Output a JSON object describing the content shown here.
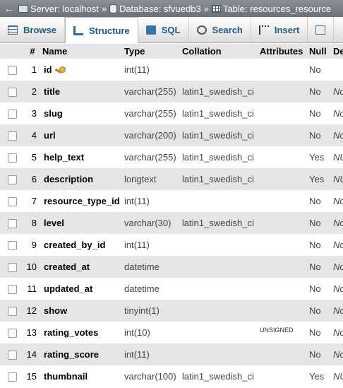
{
  "breadcrumb": {
    "server": "Server: localhost",
    "database": "Database: sfvuedb3",
    "table": "Table: resources_resource",
    "separator": "»"
  },
  "tabs": [
    {
      "label": "Browse",
      "icon": "browse-icon"
    },
    {
      "label": "Structure",
      "icon": "structure-icon",
      "active": true
    },
    {
      "label": "SQL",
      "icon": "sql-icon"
    },
    {
      "label": "Search",
      "icon": "search-icon"
    },
    {
      "label": "Insert",
      "icon": "insert-icon"
    }
  ],
  "columns": {
    "num": "#",
    "name": "Name",
    "type": "Type",
    "collation": "Collation",
    "attributes": "Attributes",
    "null": "Null",
    "default": "De"
  },
  "rows": [
    {
      "num": "1",
      "name": "id",
      "type": "int(11)",
      "collation": "",
      "attributes": "",
      "null": "No",
      "default": "",
      "primary_key": true
    },
    {
      "num": "2",
      "name": "title",
      "type": "varchar(255)",
      "collation": "latin1_swedish_ci",
      "attributes": "",
      "null": "No",
      "default": "No"
    },
    {
      "num": "3",
      "name": "slug",
      "type": "varchar(255)",
      "collation": "latin1_swedish_ci",
      "attributes": "",
      "null": "No",
      "default": "No"
    },
    {
      "num": "4",
      "name": "url",
      "type": "varchar(200)",
      "collation": "latin1_swedish_ci",
      "attributes": "",
      "null": "No",
      "default": "No"
    },
    {
      "num": "5",
      "name": "help_text",
      "type": "varchar(255)",
      "collation": "latin1_swedish_ci",
      "attributes": "",
      "null": "Yes",
      "default": "NU"
    },
    {
      "num": "6",
      "name": "description",
      "type": "longtext",
      "collation": "latin1_swedish_ci",
      "attributes": "",
      "null": "Yes",
      "default": "NU"
    },
    {
      "num": "7",
      "name": "resource_type_id",
      "type": "int(11)",
      "collation": "",
      "attributes": "",
      "null": "No",
      "default": "No"
    },
    {
      "num": "8",
      "name": "level",
      "type": "varchar(30)",
      "collation": "latin1_swedish_ci",
      "attributes": "",
      "null": "No",
      "default": "No"
    },
    {
      "num": "9",
      "name": "created_by_id",
      "type": "int(11)",
      "collation": "",
      "attributes": "",
      "null": "No",
      "default": "No"
    },
    {
      "num": "10",
      "name": "created_at",
      "type": "datetime",
      "collation": "",
      "attributes": "",
      "null": "No",
      "default": "No"
    },
    {
      "num": "11",
      "name": "updated_at",
      "type": "datetime",
      "collation": "",
      "attributes": "",
      "null": "No",
      "default": "No"
    },
    {
      "num": "12",
      "name": "show",
      "type": "tinyint(1)",
      "collation": "",
      "attributes": "",
      "null": "No",
      "default": "No"
    },
    {
      "num": "13",
      "name": "rating_votes",
      "type": "int(10)",
      "collation": "",
      "attributes": "UNSIGNED",
      "null": "No",
      "default": "No"
    },
    {
      "num": "14",
      "name": "rating_score",
      "type": "int(11)",
      "collation": "",
      "attributes": "",
      "null": "No",
      "default": "No"
    },
    {
      "num": "15",
      "name": "thumbnail",
      "type": "varchar(100)",
      "collation": "latin1_swedish_ci",
      "attributes": "",
      "null": "Yes",
      "default": "NU"
    }
  ]
}
